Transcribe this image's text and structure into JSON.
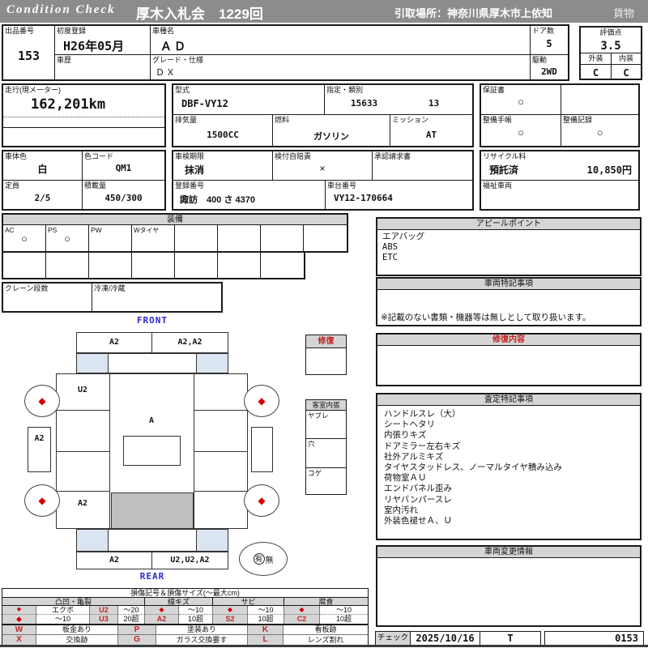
{
  "header": {
    "brand": "Condition Check",
    "auction": "厚木入札会　1229回",
    "pickup": "引取場所：神奈川県厚木市上依知",
    "category": "貨物"
  },
  "info": {
    "lot_label": "出品番号",
    "lot_no": "153",
    "first_reg_label": "初度登録",
    "first_reg": "H26年05月",
    "model_name_label": "車種名",
    "model_name": "ＡＤ",
    "history_label": "車歴",
    "history": "",
    "grade_label": "グレード・仕様",
    "grade": "ＤＸ",
    "doors_label": "ドア数",
    "doors": "5",
    "drive_label": "駆動",
    "drive": "2WD",
    "score_label": "評価点",
    "score": "3.5",
    "exterior_label": "外装",
    "exterior": "C",
    "interior_label": "内装",
    "interior": "C",
    "mileage_label": "走行(現メーター)",
    "mileage": "162,201km",
    "model_code_label": "型式",
    "model_code": "DBF-VY12",
    "class_label": "指定・類別",
    "class_no": "15633",
    "class_no2": "13",
    "warranty_label": "保証書",
    "warranty": "○",
    "displacement_label": "排気量",
    "displacement": "1500CC",
    "fuel_label": "燃料",
    "fuel": "ガソリン",
    "transmission_label": "ミッション",
    "transmission": "AT",
    "maintenance_book_label": "整備手帳",
    "maintenance_book": "○",
    "maintenance_record_label": "整備記録",
    "maintenance_record": "○",
    "body_color_label": "車体色",
    "body_color": "白",
    "color_code_label": "色コード",
    "color_code": "QM1",
    "inspection_label": "車検期限",
    "inspection": "抹消",
    "insurance_label": "検付自賠責",
    "insurance": "×",
    "approval_label": "承認請求書",
    "approval": "",
    "capacity_label": "定員",
    "capacity": "2/5",
    "load_label": "積載量",
    "load": "450/300",
    "reg_no_label": "登録番号",
    "reg_no": "諏訪　400 さ 4370",
    "chassis_label": "車台番号",
    "chassis_no": "VY12-170664",
    "recycle_label": "リサイクル料",
    "recycle_status": "預託済",
    "recycle_fee": "10,850円",
    "welfare_label": "福祉車両",
    "welfare": ""
  },
  "equipment": {
    "title": "装備",
    "row1": [
      {
        "label": "AC",
        "value": "○"
      },
      {
        "label": "PS",
        "value": "○"
      },
      {
        "label": "PW",
        "value": ""
      },
      {
        "label": "Wタイヤ",
        "value": ""
      },
      {
        "label": "",
        "value": ""
      },
      {
        "label": "",
        "value": ""
      },
      {
        "label": "",
        "value": ""
      },
      {
        "label": "",
        "value": ""
      }
    ],
    "crane_label": "クレーン段数",
    "crane": "",
    "fridge_label": "冷凍/冷蔵",
    "fridge": ""
  },
  "diagram": {
    "front_label": "FRONT",
    "rear_label": "REAR",
    "front_bumper_left": "A2",
    "front_bumper_right": "A2,A2",
    "left_front_fender": "U2",
    "left_door": "A2",
    "left_rear_quarter": "A2",
    "windshield_mark": "A",
    "rear_bumper_left": "A2",
    "rear_bumper_right": "U2,U2,A2",
    "wheel_mark": "◆",
    "spare_has": "有",
    "spare_none": "無"
  },
  "repair": {
    "title": "修復",
    "content": ""
  },
  "cabin": {
    "title": "客室内張",
    "items": [
      "ヤブレ",
      "穴",
      "コゲ"
    ]
  },
  "appeal": {
    "title": "アピールポイント",
    "items": [
      "エアバッグ",
      "ABS",
      "ETC"
    ]
  },
  "vehicle_notes": {
    "title": "車両特記事項",
    "note": "※記載のない書類・機器等は無しとして取り扱います。"
  },
  "repair_detail": {
    "title": "修復内容",
    "content": ""
  },
  "assessment": {
    "title": "査定特記事項",
    "items": [
      "ハンドルスレ（大）",
      "シートヘタリ",
      "内張りキズ",
      "ドアミラー左右キズ",
      "社外アルミキズ",
      "タイヤスタッドレス、ノーマルタイヤ積み込み",
      "荷物室ＡＵ",
      "エンドパネル歪み",
      "リヤバンパースレ",
      "室内汚れ",
      "外装色褪せＡ、Ｕ"
    ]
  },
  "change_info": {
    "title": "車両変更情報",
    "content": ""
  },
  "check": {
    "label": "チェック",
    "date": "2025/10/16",
    "inspector": "T",
    "sheet_no": "0153"
  },
  "legend": {
    "title": "損傷記号＆損傷サイズ(〜最大cm)",
    "diamond": "◆",
    "groups": [
      "凸凹・亀裂",
      "線キズ",
      "サビ",
      "腐食"
    ],
    "row1": [
      "◆",
      "エクボ",
      "U2",
      "〜20",
      "◆",
      "〜10",
      "◆",
      "〜10",
      "◆",
      "〜10"
    ],
    "row2": [
      "◆",
      "〜10",
      "U3",
      "20超",
      "A2",
      "10超",
      "S2",
      "10超",
      "C2",
      "10超"
    ],
    "row3": [
      "W",
      "板金あり",
      "P",
      "塗装あり",
      "K",
      "看板跡"
    ],
    "row4": [
      "X",
      "交換跡",
      "G",
      "ガラス交換要す",
      "L",
      "レンズ割れ"
    ]
  },
  "colors": {
    "title_bar_gray": "#8c8c8c",
    "section_bar_gray": "#d5d5d5",
    "accent_red": "#c22222",
    "label_blue": "#2828c8",
    "panel_light_blue": "#dbe5f1",
    "cargo_gray": "#bfbfbf",
    "mark_red": "#d40000"
  }
}
